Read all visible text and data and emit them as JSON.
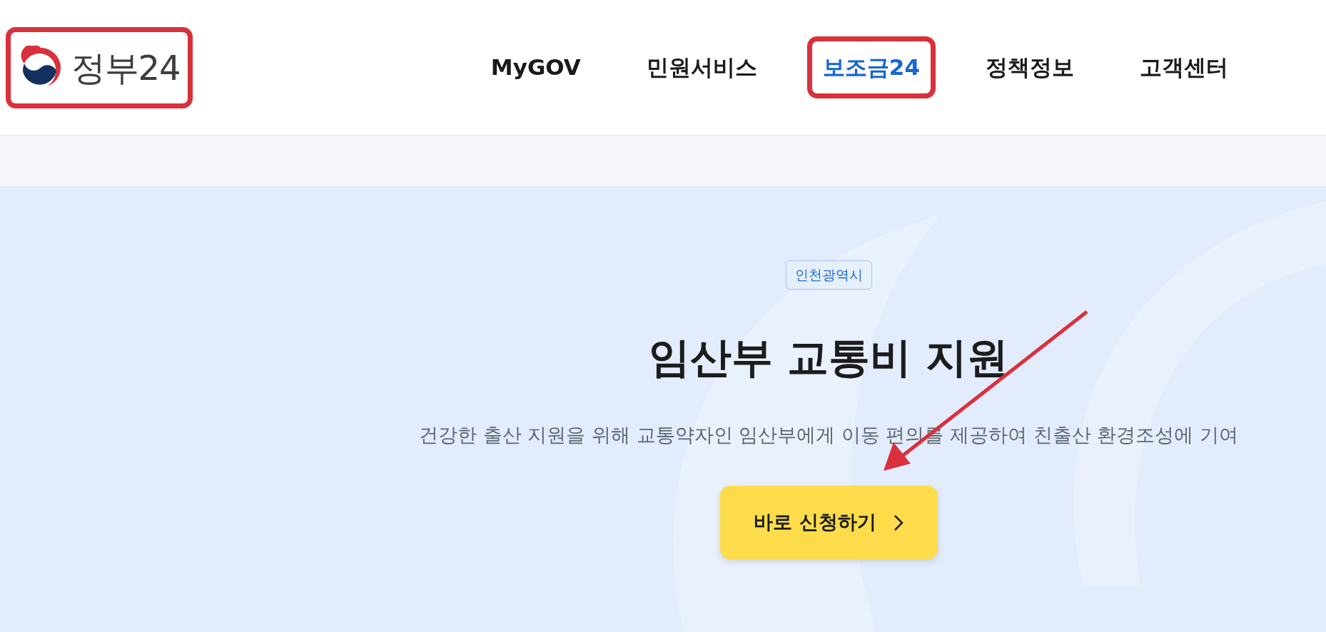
{
  "header": {
    "logo": {
      "text": "정부24",
      "annotated": true
    },
    "nav": [
      {
        "label": "MyGOV",
        "selected": false,
        "annotated": false
      },
      {
        "label": "민원서비스",
        "selected": false,
        "annotated": false
      },
      {
        "label": "보조금24",
        "selected": true,
        "annotated": true
      },
      {
        "label": "정책정보",
        "selected": false,
        "annotated": false
      },
      {
        "label": "고객센터",
        "selected": false,
        "annotated": false
      }
    ]
  },
  "hero": {
    "region_tag": "인천광역시",
    "title": "임산부 교통비 지원",
    "description": "건강한 출산 지원을 위해 교통약자인 임산부에게 이동 편의를 제공하여 친출산 환경조성에 기여",
    "apply_button": "바로 신청하기",
    "annotation_arrow": true
  }
}
